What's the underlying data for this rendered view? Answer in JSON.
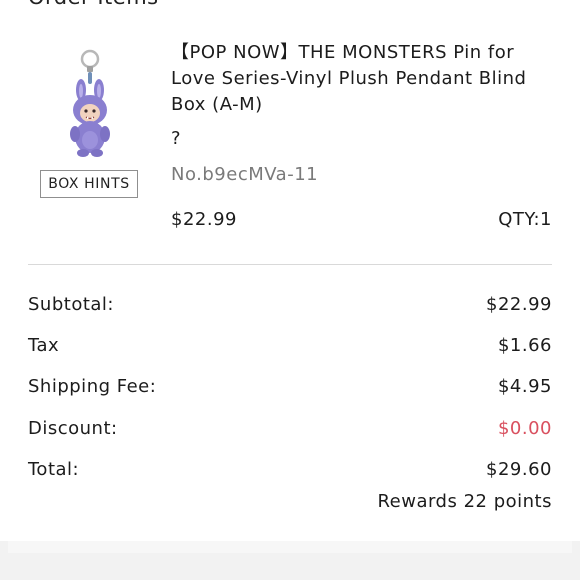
{
  "section": {
    "title": "Order Items"
  },
  "item": {
    "image_icon": "monster-plush-pendant-image",
    "box_hints_label": "BOX HINTS",
    "name": "【POP NOW】THE MONSTERS Pin for Love Series-Vinyl Plush Pendant Blind Box (A-M)",
    "variant": "?",
    "sku": "No.b9ecMVa-11",
    "price": "$22.99",
    "qty": "QTY:1"
  },
  "summary": {
    "subtotal_label": "Subtotal:",
    "subtotal_value": "$22.99",
    "tax_label": "Tax",
    "tax_value": "$1.66",
    "shipping_label": "Shipping Fee:",
    "shipping_value": "$4.95",
    "discount_label": "Discount:",
    "discount_value": "$0.00",
    "total_label": "Total:",
    "total_value": "$29.60",
    "rewards": "Rewards 22 points"
  },
  "colors": {
    "discount": "#d9505f",
    "muted_text": "#7a7a7a",
    "divider": "#d9d9d9",
    "plush_purple": "#8a7fd0"
  }
}
